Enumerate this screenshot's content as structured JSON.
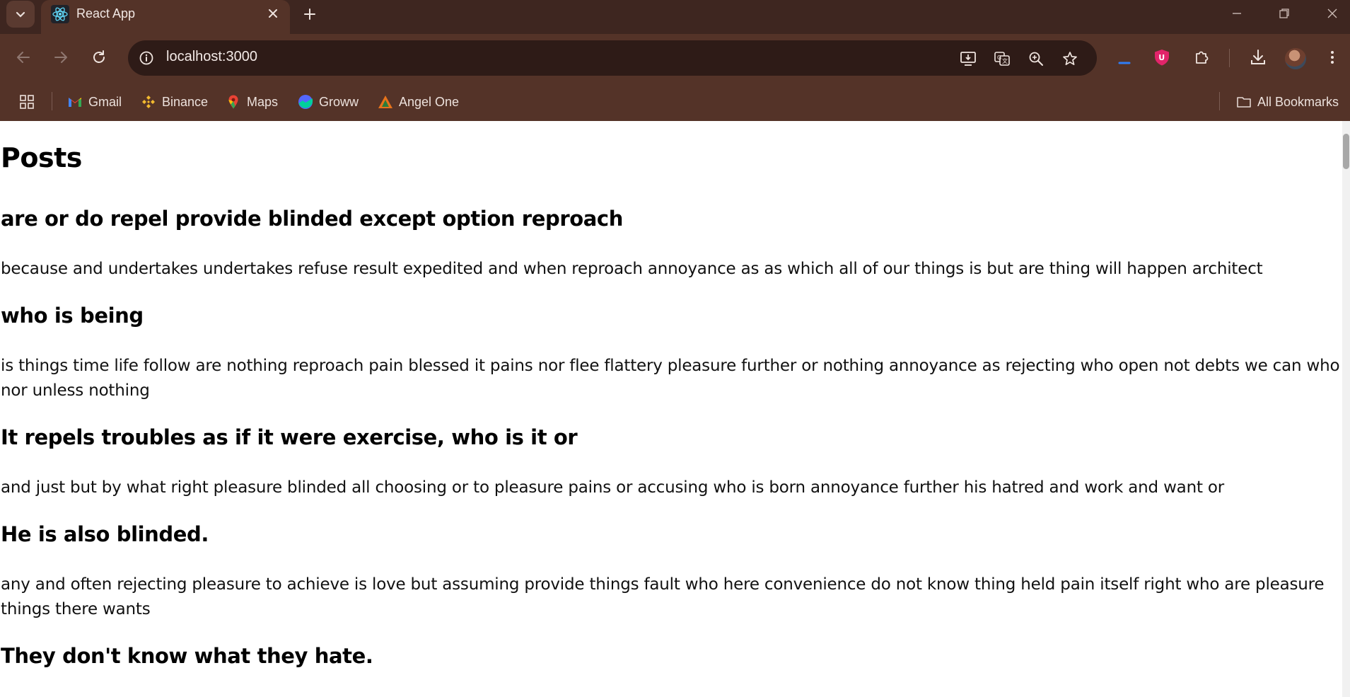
{
  "browser": {
    "tab_title": "React App",
    "url": "localhost:3000",
    "bookmarks": [
      {
        "label": "Gmail",
        "icon": "gmail-icon",
        "color": "#ea4335"
      },
      {
        "label": "Binance",
        "icon": "binance-icon",
        "color": "#f3ba2f"
      },
      {
        "label": "Maps",
        "icon": "maps-icon",
        "color": "#34a853"
      },
      {
        "label": "Groww",
        "icon": "groww-icon",
        "color": "#5367ff"
      },
      {
        "label": "Angel One",
        "icon": "angel-one-icon",
        "color": "#e8731b"
      }
    ],
    "all_bookmarks_label": "All Bookmarks"
  },
  "page": {
    "heading": "Posts",
    "posts": [
      {
        "title": "are or do repel provide blinded except option reproach",
        "body": "because and undertakes undertakes refuse result expedited and when reproach annoyance as as which all of our things is but are thing will happen architect"
      },
      {
        "title": "who is being",
        "body": "is things time life follow are nothing reproach pain blessed it pains nor flee flattery pleasure further or nothing annoyance as rejecting who open not debts we can who nor unless nothing"
      },
      {
        "title": "It repels troubles as if it were exercise, who is it or",
        "body": "and just but by what right pleasure blinded all choosing or to pleasure pains or accusing who is born annoyance further his hatred and work and want or"
      },
      {
        "title": "He is also blinded.",
        "body": "any and often rejecting pleasure to achieve is love but assuming provide things fault who here convenience do not know thing held pain itself right who are pleasure things there wants"
      },
      {
        "title": "They don't know what they hate.",
        "body": ""
      }
    ]
  }
}
